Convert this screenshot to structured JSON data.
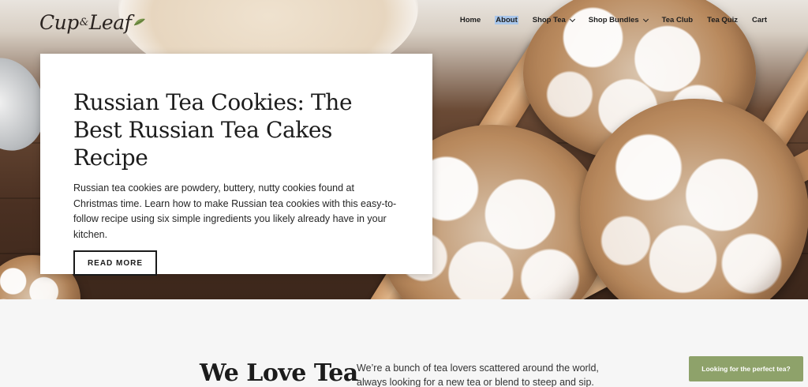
{
  "header": {
    "logo_part1": "Cup",
    "logo_amp": "&",
    "logo_part2": "Leaf"
  },
  "nav": {
    "items": [
      {
        "label": "Home"
      },
      {
        "label": "About"
      },
      {
        "label": "Shop Tea"
      },
      {
        "label": "Shop Bundles"
      },
      {
        "label": "Tea Club"
      },
      {
        "label": "Tea Quiz"
      },
      {
        "label": "Cart"
      }
    ]
  },
  "hero": {
    "title": "Russian Tea Cookies: The Best Russian Tea Cakes Recipe",
    "description": "Russian tea cookies are powdery, buttery, nutty cookies found at Christmas time. Learn how to make Russian tea cookies with this easy-to-follow recipe using six simple ingredients you likely already have in your kitchen.",
    "button_label": "READ MORE"
  },
  "about": {
    "title": "We Love Tea",
    "text": "We’re a bunch of tea lovers scattered around the world, always looking for a new tea or blend to steep and sip. We"
  },
  "cta": {
    "label": "Looking for the perfect tea?"
  },
  "colors": {
    "cta_bg": "#8ea26a",
    "selection_highlight": "#a9c6ea"
  }
}
